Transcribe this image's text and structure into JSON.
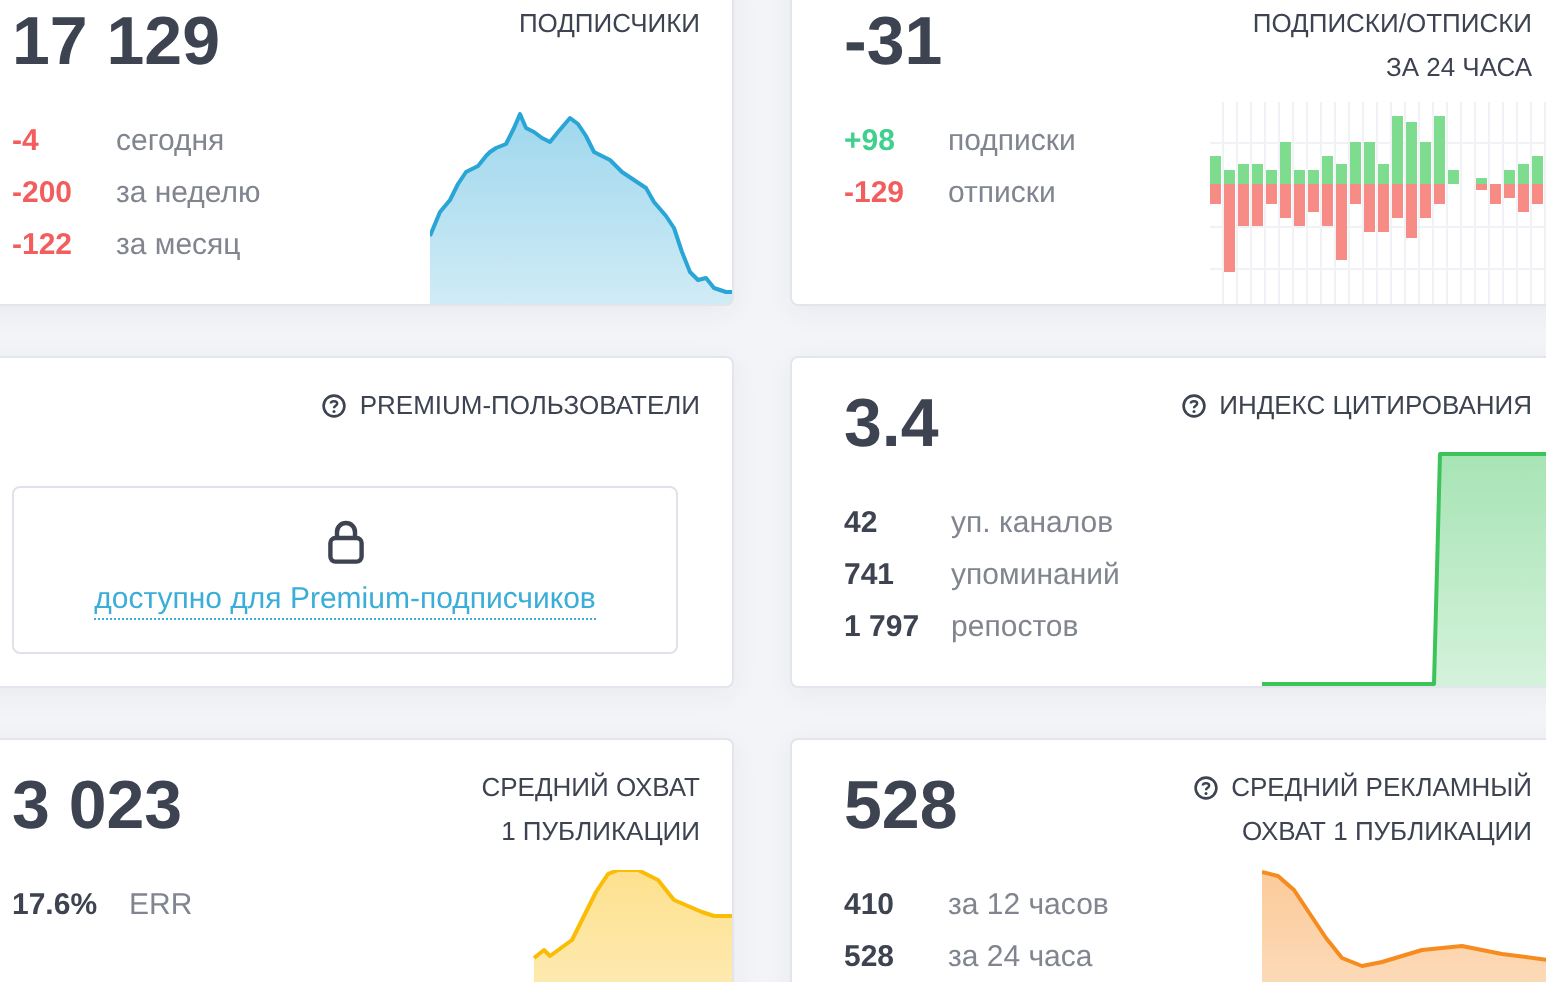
{
  "cards": [
    {
      "kind": "stats",
      "value": "17 129",
      "title_lines": [
        "ПОДПИСЧИКИ"
      ],
      "help_icon": false,
      "stats": [
        {
          "value": "-4",
          "label": "сегодня",
          "color": "#f25d5d"
        },
        {
          "value": "-200",
          "label": "за неделю",
          "color": "#f25d5d"
        },
        {
          "value": "-122",
          "label": "за месяц",
          "color": "#f25d5d"
        }
      ],
      "chart": {
        "kind": "area",
        "color": "#29a6d6"
      }
    },
    {
      "kind": "stats",
      "value": "-31",
      "title_lines": [
        "ПОДПИСКИ/ОТПИСКИ",
        "ЗА 24 ЧАСА"
      ],
      "help_icon": false,
      "stats": [
        {
          "value": "+98",
          "label": "подписки",
          "color": "#3fcf8e"
        },
        {
          "value": "-129",
          "label": "отписки",
          "color": "#f25d5d"
        }
      ],
      "chart": {
        "kind": "bars"
      }
    },
    {
      "kind": "locked",
      "title_lines": [
        "PREMIUM-ПОЛЬЗОВАТЕЛИ"
      ],
      "help_icon": true,
      "link": "доступно для Premium-подписчиков"
    },
    {
      "kind": "stats",
      "value": "3.4",
      "title_lines": [
        "ИНДЕКС ЦИТИРОВАНИЯ"
      ],
      "help_icon": true,
      "stats": [
        {
          "value": "42",
          "label": "уп. каналов",
          "color": "#3d4350"
        },
        {
          "value": "741",
          "label": "упоминаний",
          "color": "#3d4350"
        },
        {
          "value": "1 797",
          "label": "репостов",
          "color": "#3d4350"
        }
      ],
      "chart": {
        "kind": "area",
        "color": "#3cc35a"
      }
    },
    {
      "kind": "stats",
      "value": "3 023",
      "title_lines": [
        "СРЕДНИЙ ОХВАТ",
        "1 ПУБЛИКАЦИИ"
      ],
      "help_icon": false,
      "stats": [
        {
          "value": "17.6%",
          "label": "ERR",
          "color": "#3d4350"
        }
      ],
      "chart": {
        "kind": "area",
        "color": "#fbbc05"
      }
    },
    {
      "kind": "stats",
      "value": "528",
      "title_lines": [
        "СРЕДНИЙ РЕКЛАМНЫЙ",
        "ОХВАТ 1 ПУБЛИКАЦИИ"
      ],
      "help_icon": true,
      "stats": [
        {
          "value": "410",
          "label": "за 12 часов",
          "color": "#3d4350"
        },
        {
          "value": "528",
          "label": "за 24 часа",
          "color": "#3d4350"
        }
      ],
      "chart": {
        "kind": "area",
        "color": "#f68b1f"
      }
    }
  ]
}
